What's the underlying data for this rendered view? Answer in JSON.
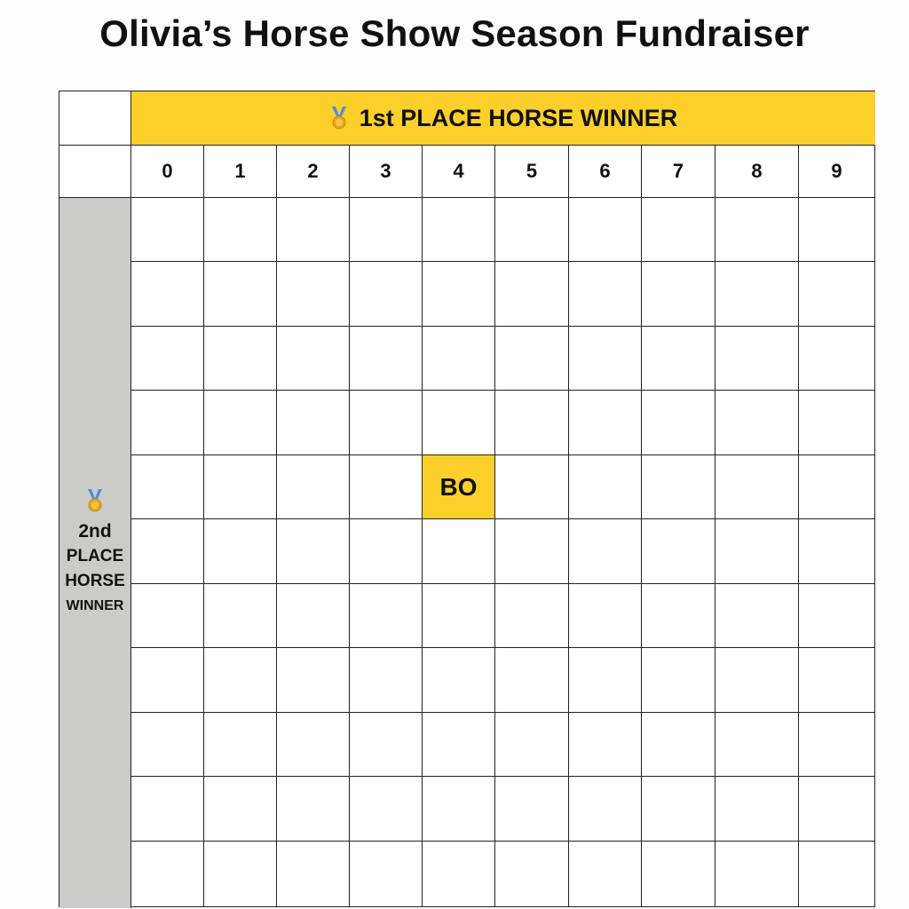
{
  "title": "Olivia’s Horse Show Season Fundraiser",
  "column_header": {
    "label": "1st PLACE HORSE WINNER",
    "icon": "medal-icon",
    "color": "#fccf2a"
  },
  "row_header": {
    "line1": "2nd",
    "line2": "PLACE",
    "line3": "HORSE",
    "line4": "WINNER",
    "icon": "medal-icon",
    "color": "#cbcbc8"
  },
  "column_numbers": [
    "0",
    "1",
    "2",
    "3",
    "4",
    "5",
    "6",
    "7",
    "8",
    "9"
  ],
  "claimed_squares": [
    {
      "row": 4,
      "col": 4,
      "initials": "BO"
    }
  ],
  "colors": {
    "highlight": "#fccf2a",
    "grid_line": "#222222"
  }
}
